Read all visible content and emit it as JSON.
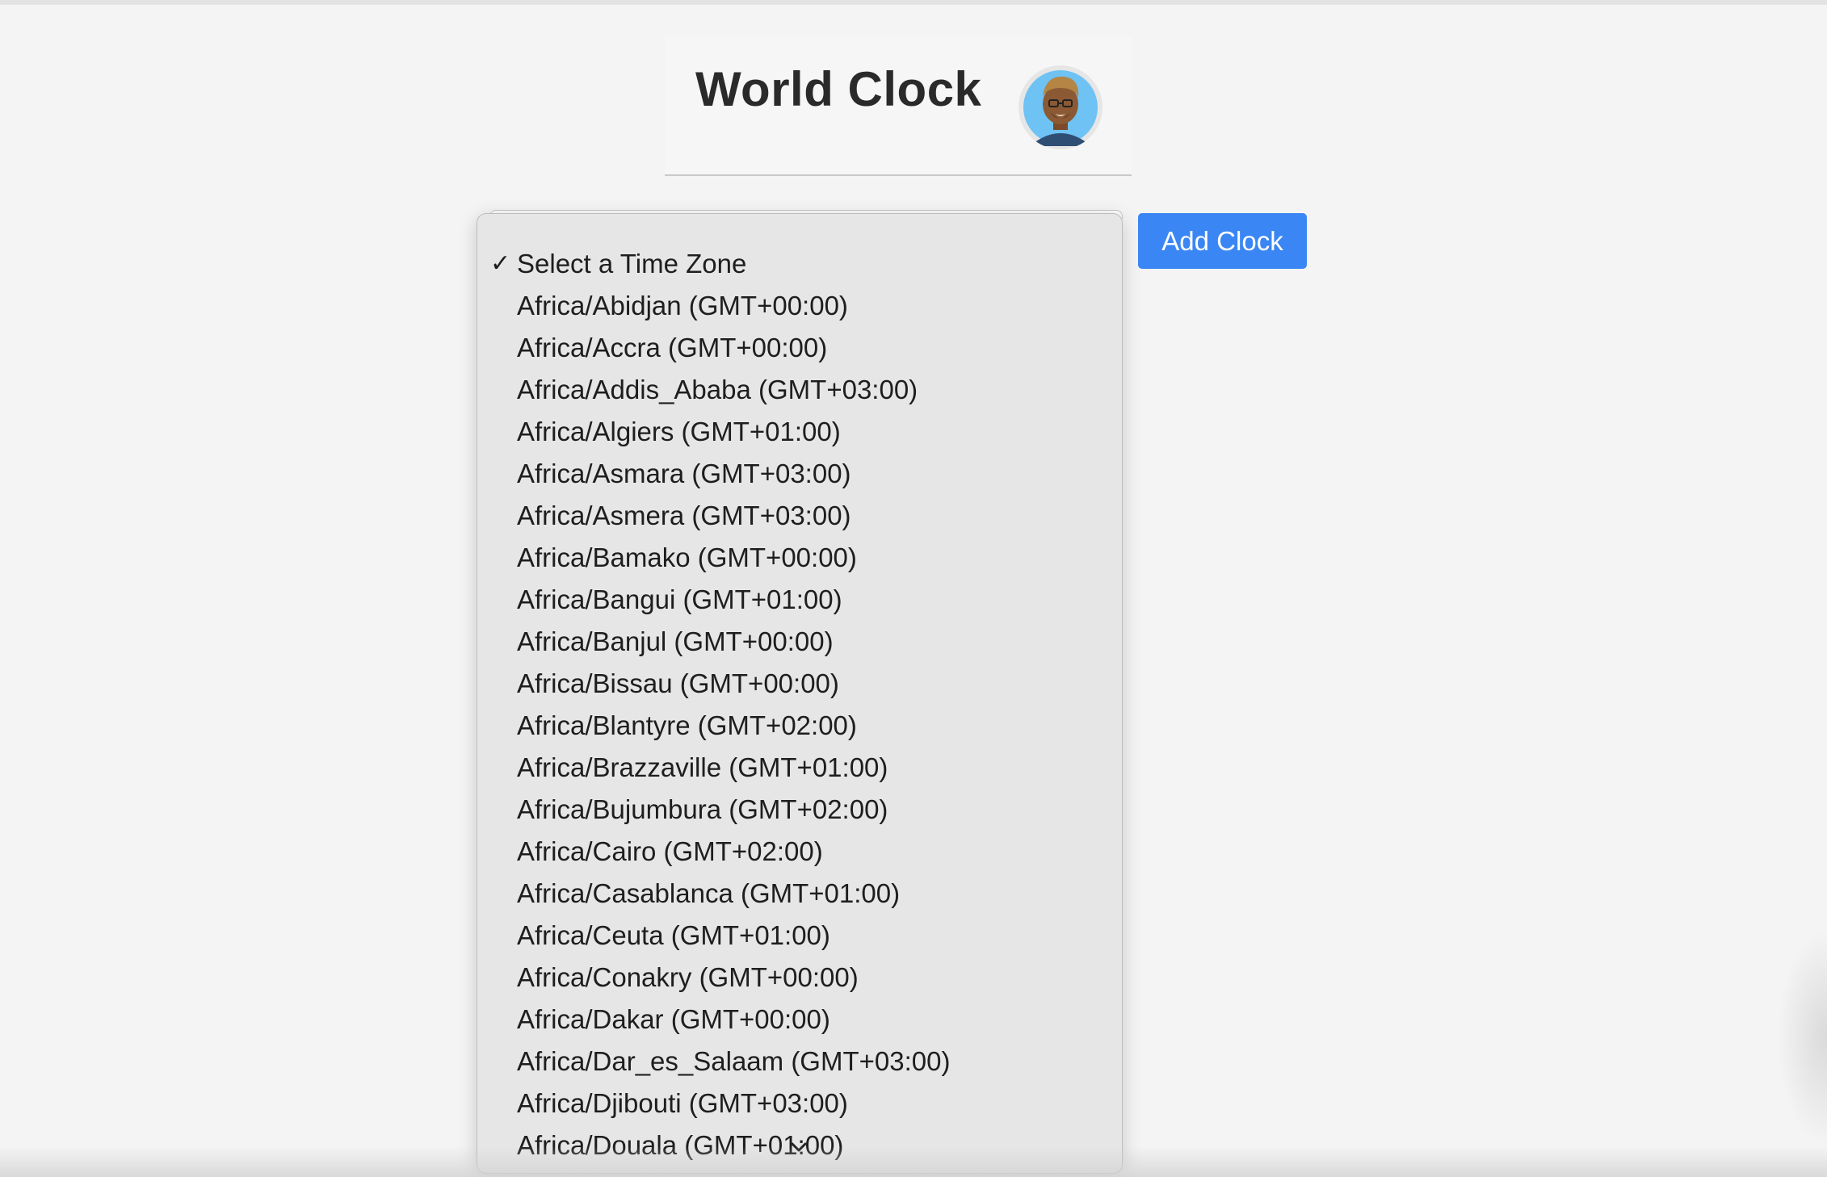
{
  "app": {
    "title": "World Clock",
    "accent_color": "#3a86f4"
  },
  "avatar": {
    "icon": "user-avatar-icon"
  },
  "controls": {
    "add_button_label": "Add Clock"
  },
  "timezone_select": {
    "selected": "Select a Time Zone",
    "checkmark": "✓",
    "options": [
      "Select a Time Zone",
      "Africa/Abidjan (GMT+00:00)",
      "Africa/Accra (GMT+00:00)",
      "Africa/Addis_Ababa (GMT+03:00)",
      "Africa/Algiers (GMT+01:00)",
      "Africa/Asmara (GMT+03:00)",
      "Africa/Asmera (GMT+03:00)",
      "Africa/Bamako (GMT+00:00)",
      "Africa/Bangui (GMT+01:00)",
      "Africa/Banjul (GMT+00:00)",
      "Africa/Bissau (GMT+00:00)",
      "Africa/Blantyre (GMT+02:00)",
      "Africa/Brazzaville (GMT+01:00)",
      "Africa/Bujumbura (GMT+02:00)",
      "Africa/Cairo (GMT+02:00)",
      "Africa/Casablanca (GMT+01:00)",
      "Africa/Ceuta (GMT+01:00)",
      "Africa/Conakry (GMT+00:00)",
      "Africa/Dakar (GMT+00:00)",
      "Africa/Dar_es_Salaam (GMT+03:00)",
      "Africa/Djibouti (GMT+03:00)",
      "Africa/Douala (GMT+01:00)"
    ],
    "scroll_icon": "chevron-down-icon"
  }
}
